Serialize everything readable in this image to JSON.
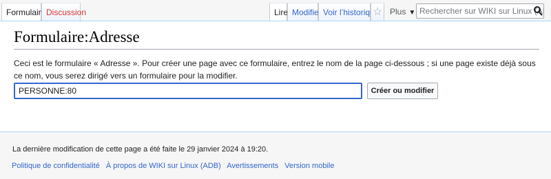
{
  "tabs": {
    "form": "Formulaire",
    "discussion": "Discussion",
    "read": "Lire",
    "edit": "Modifier",
    "history": "Voir l’historique",
    "watch_icon": "star-icon",
    "more": "Plus",
    "more_icon": "chevron-down-icon"
  },
  "search": {
    "placeholder": "Rechercher sur WIKI sur Linux (ADB)",
    "icon": "search-icon"
  },
  "main": {
    "title": "Formulaire:Adresse",
    "intro": "Ceci est le formulaire « Adresse  ». Pour créer une page avec ce formulaire, entrez le nom de la page ci-dessous ; si une page existe déjà sous ce nom, vous serez dirigé vers un formulaire pour la modifier.",
    "input_value": "PERSONNE:80",
    "button": "Créer ou modifier"
  },
  "footer": {
    "last_modified": "La dernière modification de cette page a été faite le 29 janvier 2024 à 19:20.",
    "links": [
      "Politique de confidentialité",
      "À propos de WIKI sur Linux (ADB)",
      "Avertissements",
      "Version mobile"
    ]
  },
  "colors": {
    "link": "#3366cc",
    "new_link": "#d73333",
    "border_blue": "#a7d7f9"
  }
}
